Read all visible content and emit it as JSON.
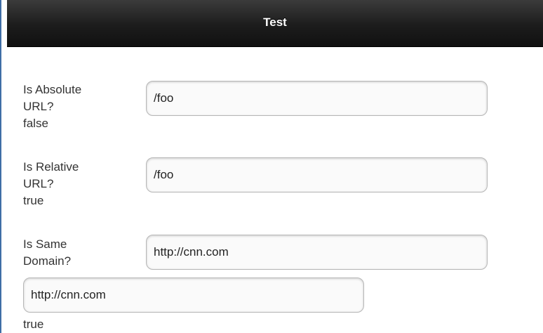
{
  "header": {
    "title": "Test"
  },
  "rows": [
    {
      "label_line1": "Is Absolute",
      "label_line2": "URL?",
      "result": "false",
      "input_value": "/foo"
    },
    {
      "label_line1": "Is Relative",
      "label_line2": "URL?",
      "result": "true",
      "input_value": "/foo"
    },
    {
      "label_line1": "Is Same",
      "label_line2": "Domain?",
      "input_value": "http://cnn.com",
      "second_input_value": "http://cnn.com",
      "result": "true"
    }
  ],
  "colors": {
    "header_bg": "#1c1c1c",
    "header_text": "#ffffff",
    "left_border": "#3f6ea6"
  }
}
